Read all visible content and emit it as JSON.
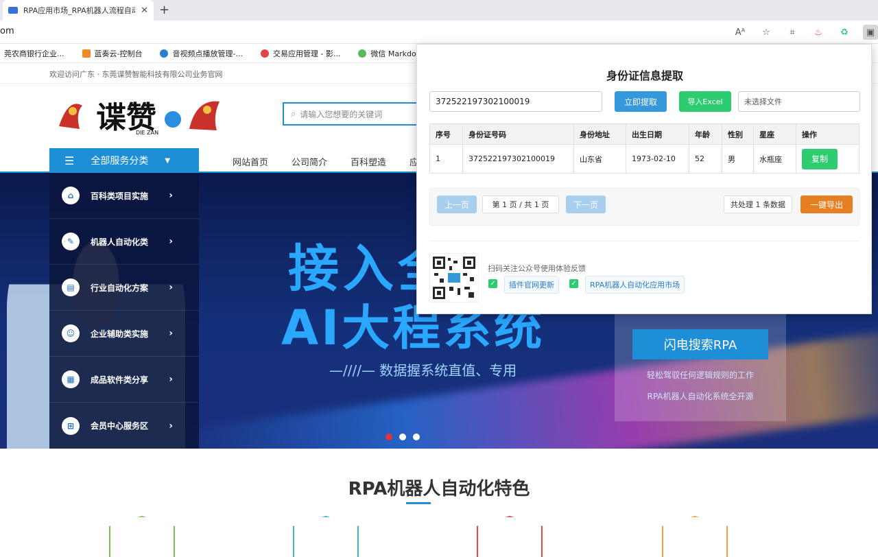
{
  "browser": {
    "tab_title": "RPA应用市场_RPA机器人流程自动化",
    "new_tab": "+",
    "url": "om",
    "bookmarks": [
      {
        "label": "莞农商银行企业...",
        "color": "#d94f3a"
      },
      {
        "label": "蓝奏云-控制台",
        "color": "#f08a24"
      },
      {
        "label": "音视频点播放管理-...",
        "color": "#2a7fd4"
      },
      {
        "label": "交易应用管理 - 影...",
        "color": "#e04545"
      },
      {
        "label": "微信 Markdown 编...",
        "color": "#5bb85d"
      }
    ]
  },
  "site": {
    "welcome": "欢迎访问广东 · 东莞谍赞智能科技有限公司业务官网",
    "logo_text": "谍赞",
    "logo_sub": "DIE ZAN",
    "search_placeholder": "请输入您想要的关键词",
    "all_categories": "全部服务分类",
    "nav": [
      "网站首页",
      "公司简介",
      "百科塑造",
      "应"
    ],
    "side_menu": [
      {
        "label": "百科类项目实施",
        "icon": "building-icon"
      },
      {
        "label": "机器人自动化类",
        "icon": "edit-icon"
      },
      {
        "label": "行业自动化方案",
        "icon": "document-icon"
      },
      {
        "label": "企业辅助类实施",
        "icon": "user-icon"
      },
      {
        "label": "成品软件类分享",
        "icon": "keyboard-icon"
      },
      {
        "label": "会员中心服务区",
        "icon": "grid-icon"
      }
    ],
    "banner": {
      "headline1": "接入全",
      "headline2": "AI大程系统",
      "subline": "—////— 数据握系统直值、专用",
      "cta": "闪电搜索RPA",
      "cta_line1": "轻松驾驭任何逻辑规则的工作",
      "cta_line2": "RPA机器人自动化系统全开源"
    },
    "section_title": "RPA机器人自动化特色",
    "hex_colors": [
      "#7cc352",
      "#3fb3d8",
      "#e04a4a",
      "#f0a03a"
    ]
  },
  "popup": {
    "title": "身份证信息提取",
    "id_value": "372522197302100019",
    "extract_button": "立即提取",
    "excel_button": "导入Excel",
    "file_placeholder": "未选择文件",
    "table": {
      "headers": [
        "序号",
        "身份证号码",
        "身份地址",
        "出生日期",
        "年龄",
        "性别",
        "星座",
        "操作"
      ],
      "rows": [
        [
          "1",
          "372522197302100019",
          "山东省",
          "1973-02-10",
          "52",
          "男",
          "水瓶座"
        ]
      ],
      "copy_label": "复制"
    },
    "pager": {
      "prev": "上一页",
      "info": "第 1 页 / 共 1 页",
      "next": "下一页",
      "count": "共处理 1 条数据",
      "export": "一键导出"
    },
    "qr_text": "扫码关注公众号使用体验反馈",
    "link1": "插件官网更新",
    "link2": "RPA机器人自动化应用市场"
  }
}
